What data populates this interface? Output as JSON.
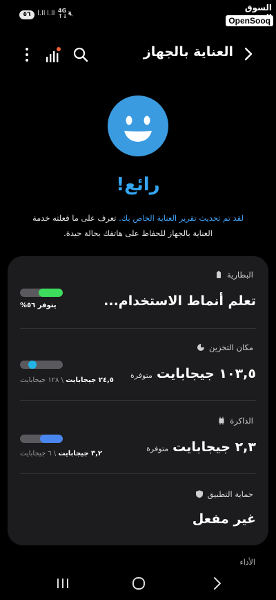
{
  "status_bar": {
    "battery": "٥٦",
    "signal1": "l.ll",
    "signal2": "l.ll",
    "network_top": "4G",
    "network_bottom": "↑↓"
  },
  "watermark": {
    "arabic": "السوق المفتوح",
    "english": "OpenSooq"
  },
  "header": {
    "title": "العناية بالجهاز"
  },
  "hero": {
    "headline": "رائع!",
    "link_text": "لقد تم تحديث تقرير العناية الخاص بك.",
    "description": " تعرف على ما فعلته خدمة العناية بالجهاز للحفاظ على هاتفك بحالة جيدة."
  },
  "sections": {
    "battery": {
      "label": "البطارية",
      "main": "تعلم أنماط الاستخدام...",
      "note": "يتوفر ٥٦%",
      "level_pct": 56,
      "color": "#3ddc5c"
    },
    "storage": {
      "label": "مكان التخزين",
      "main": "١٠٣,٥ جيجابايت",
      "sub": "متوفرة",
      "used": "٢٤,٥ جيجابايت",
      "total": "\\ ١٢٨ جيجابايت",
      "used_fraction": 0.19,
      "color": "#22b4e6"
    },
    "memory": {
      "label": "الذاكرة",
      "main": "٢,٣ جيجابايت",
      "sub": "متوفرة",
      "used": "٣,٢ جيجابايت",
      "total": "\\ ٦ جيجابايت",
      "used_fraction": 0.53,
      "color": "#4a86f0"
    },
    "app_protection": {
      "label": "حماية التطبيق",
      "main": "غير مفعل"
    }
  },
  "footer": {
    "performance": "الأداء"
  },
  "icons": {
    "back": "chevron-right-icon",
    "search": "search-icon",
    "stats": "bar-chart-icon",
    "more": "more-vertical-icon",
    "face": "smiling-face-icon"
  }
}
